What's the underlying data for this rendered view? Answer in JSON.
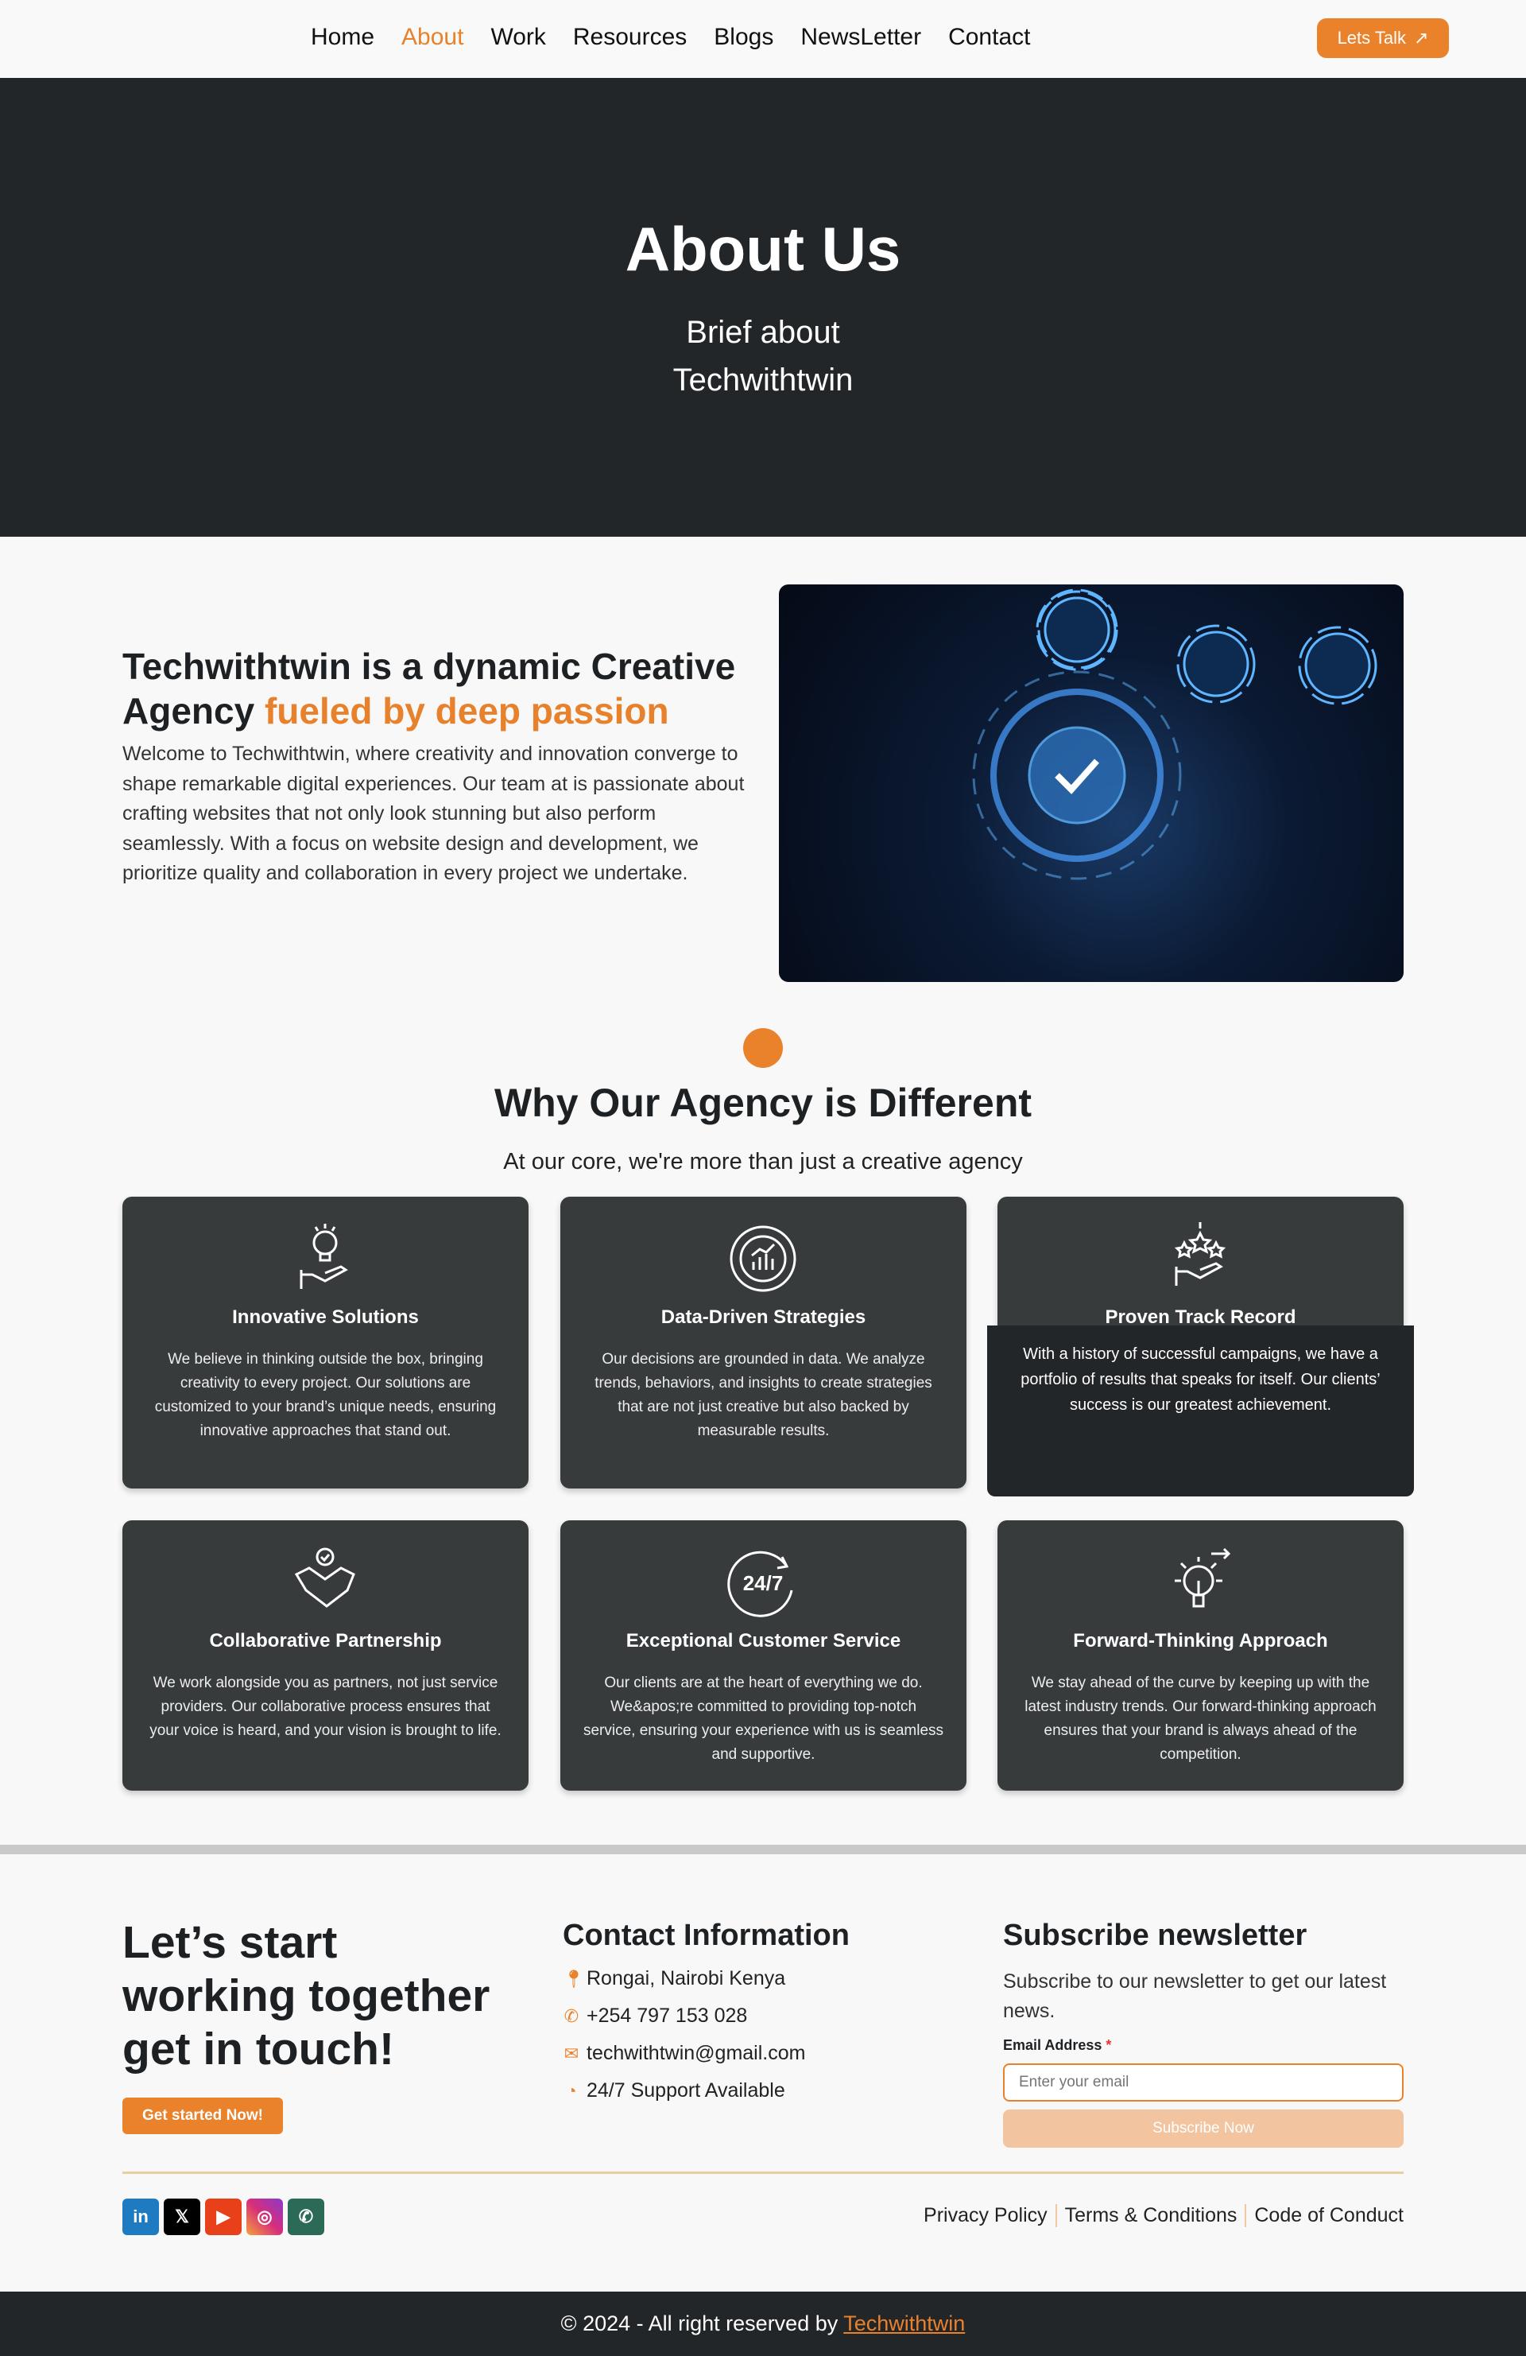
{
  "nav": {
    "links": [
      "Home",
      "About",
      "Work",
      "Resources",
      "Blogs",
      "NewsLetter",
      "Contact"
    ],
    "active": "About",
    "cta": "Lets Talk",
    "cta_icon": "↗"
  },
  "hero": {
    "title": "About Us",
    "subtitle": "Brief about Techwithtwin"
  },
  "intro": {
    "heading_plain": "Techwithtwin is a dynamic Creative Agency ",
    "heading_accent": "fueled by deep passion",
    "body": "Welcome to Techwithtwin, where creativity and innovation converge to shape remarkable digital experiences. Our team at is passionate about crafting websites that not only look stunning but also perform seamlessly. With a focus on website design and development, we prioritize quality and collaboration in every project we undertake."
  },
  "why": {
    "title": "Why Our Agency is Different",
    "subtitle": "At our core, we're more than just a creative agency",
    "cards": [
      {
        "title": "Innovative Solutions",
        "text": "We believe in thinking outside the box, bringing creativity to every project. Our solutions are customized to your brand’s unique needs, ensuring innovative approaches that stand out.",
        "icon": "lightbulb-hand-icon"
      },
      {
        "title": "Data-Driven Strategies",
        "text": "Our decisions are grounded in data. We analyze trends, behaviors, and insights to create strategies that are not just creative but also backed by measurable results.",
        "icon": "data-chart-icon"
      },
      {
        "title": "Proven Track Record",
        "text": "With a history of successful campaigns, we have a portfolio of results that speaks for itself. Our clients’ success is our greatest achievement.",
        "icon": "stars-hand-icon"
      },
      {
        "title": "Collaborative Partnership",
        "text": "We work alongside you as partners, not just service providers. Our collaborative process ensures that your voice is heard, and your vision is brought to life.",
        "icon": "handshake-icon"
      },
      {
        "title": "Exceptional Customer Service",
        "text": "Our clients are at the heart of everything we do. We&apos;re committed to providing top-notch service, ensuring your experience with us is seamless and supportive.",
        "icon": "24-7-icon"
      },
      {
        "title": "Forward-Thinking Approach",
        "text": "We stay ahead of the curve by keeping up with the latest industry trends. Our forward-thinking approach ensures that your brand is always ahead of the competition.",
        "icon": "lightbulb-arrow-icon"
      }
    ]
  },
  "footer": {
    "cta_heading": "Let’s start working together get in touch!",
    "cta_button": "Get started Now!",
    "contact": {
      "title": "Contact Information",
      "address": "Rongai, Nairobi Kenya",
      "phone": "+254 797 153 028",
      "email": "techwithtwin@gmail.com",
      "support": "24/7 Support Available"
    },
    "newsletter": {
      "title": "Subscribe newsletter",
      "text": "Subscribe to our newsletter to get our latest news.",
      "label": "Email Address",
      "required": "*",
      "placeholder": "Enter your email",
      "button": "Subscribe Now"
    },
    "links": [
      "Privacy Policy",
      "Terms & Conditions",
      "Code of Conduct"
    ],
    "copyright": "© 2024 - All right reserved by ",
    "brand": "Techwithtwin"
  },
  "colors": {
    "accent": "#ea812b",
    "dark": "#222629",
    "card": "#373b3c"
  }
}
